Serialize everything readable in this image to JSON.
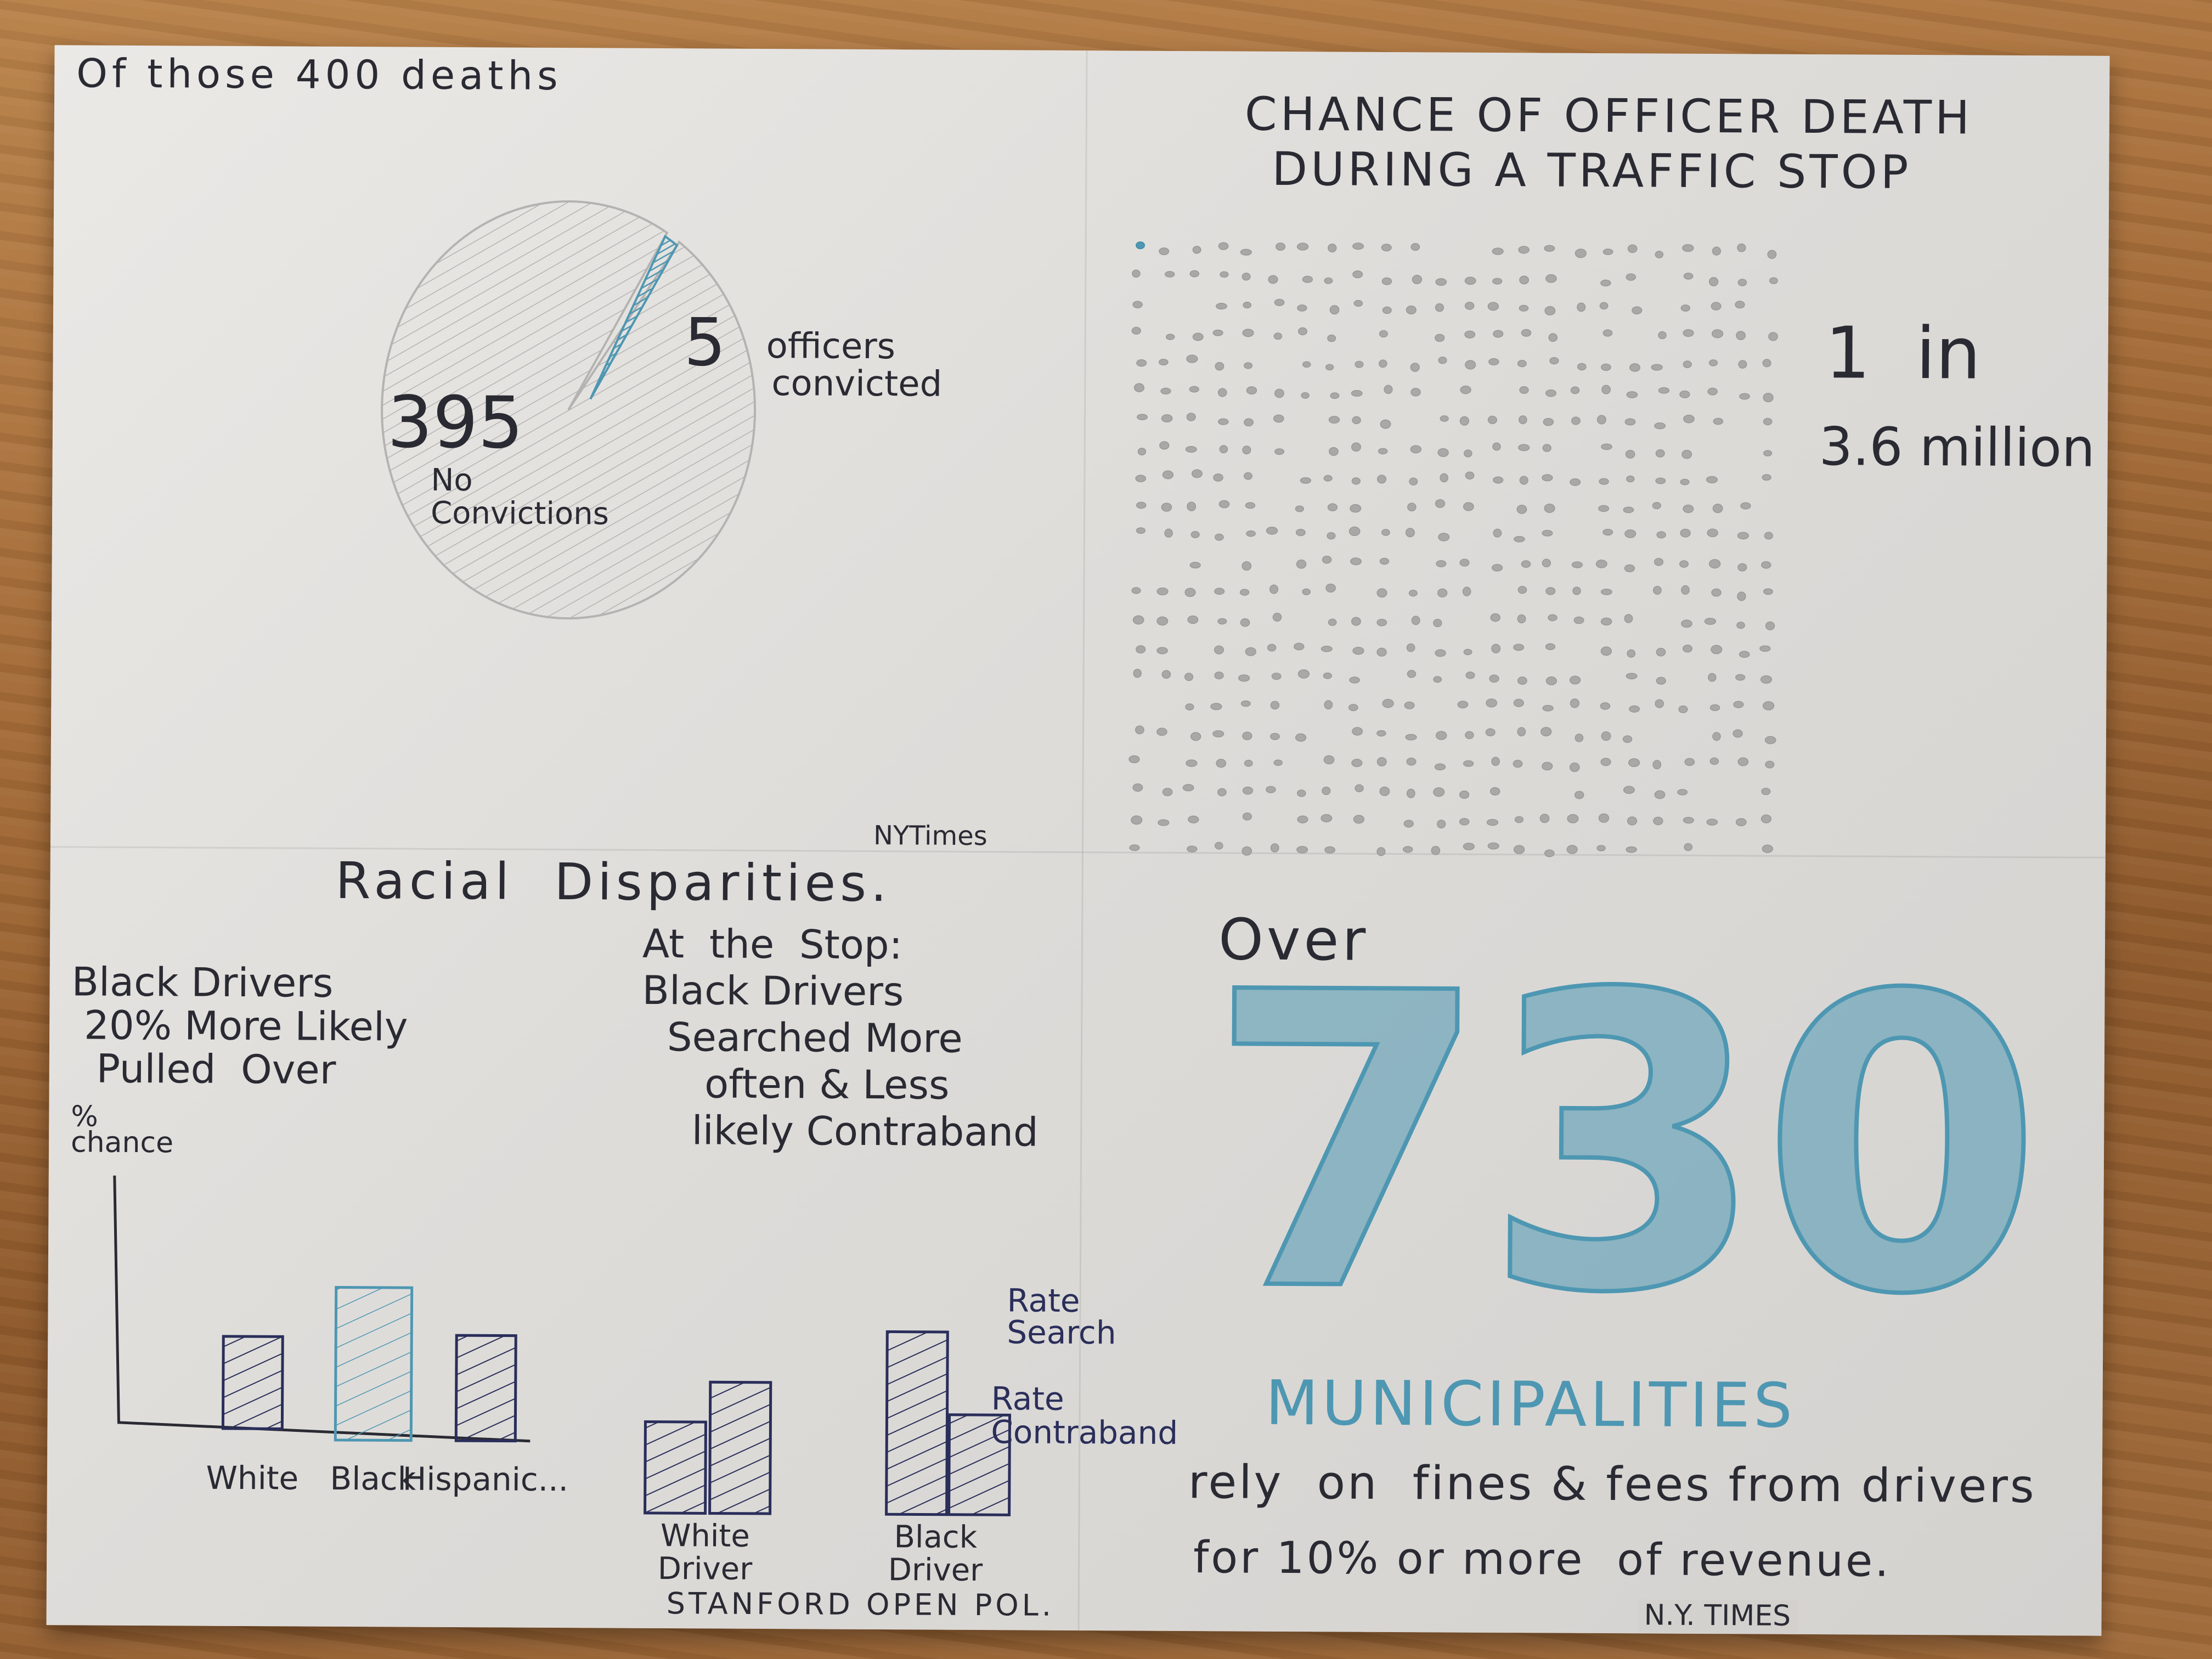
{
  "pie_panel": {
    "title": "Of those 400 deaths",
    "chart_data": {
      "type": "pie",
      "labels": [
        "No Convictions",
        "officers convicted"
      ],
      "values": [
        395,
        5
      ],
      "value_labels": [
        "395",
        "5"
      ]
    },
    "big_label": "395",
    "big_caption_1": "No",
    "big_caption_2": "Convictions",
    "small_label": "5",
    "small_caption_1": "officers",
    "small_caption_2": "convicted",
    "source": "NYTimes"
  },
  "dots_panel": {
    "title_line1": "CHANCE OF OFFICER DEATH",
    "title_line2": "DURING A TRAFFIC STOP",
    "odds_line1": "1  in",
    "odds_line2": "3.6 million"
  },
  "racial_panel": {
    "title": "Racial  Disparities.",
    "left_note": "Black Drivers\n 20% More Likely\n  Pulled  Over",
    "ylabel": "%\nchance",
    "left_chart": {
      "type": "bar",
      "categories": [
        "White",
        "Black",
        "Hispanic..."
      ],
      "values": [
        3.5,
        5.8,
        4.0
      ],
      "colors": [
        "#2a2e5a",
        "#4e97b2",
        "#2a2e5a"
      ]
    },
    "right_note": "At  the  Stop:\nBlack Drivers\n  Searched More\n     often & Less\n    likely Contraband",
    "right_chart": {
      "type": "bar",
      "categories": [
        "White\nDriver",
        "Black\nDriver"
      ],
      "series": [
        {
          "name": "Rate\nSearch",
          "values": [
            3.2,
            6.4
          ]
        },
        {
          "name": "Rate\nContraband",
          "values": [
            4.6,
            3.5
          ]
        }
      ]
    },
    "legend_search": "Rate\nSearch",
    "legend_contraband": "Rate\nContraband",
    "source": "STANFORD OPEN POL."
  },
  "munis_panel": {
    "prefix": "Over",
    "big_number": "730",
    "unit": "MUNICIPALITIES",
    "caption_1": "rely  on  fines & fees from drivers",
    "caption_2": "for 10% or more  of revenue.",
    "source": "N.Y. TIMES"
  },
  "colors": {
    "ink": "#2a2a33",
    "blue": "#4e97b2",
    "navy": "#2a2e5a",
    "paper": "#e4e2df"
  }
}
